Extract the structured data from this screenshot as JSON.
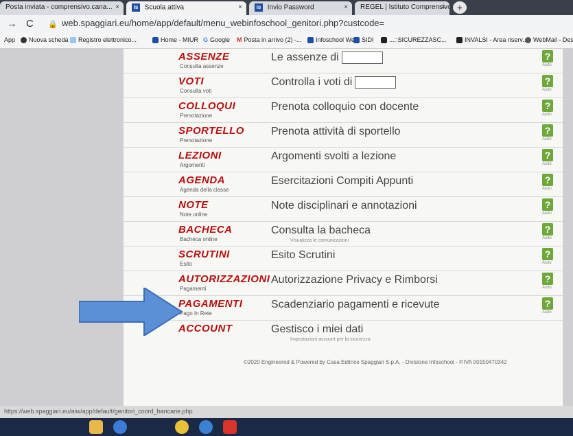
{
  "tabs": [
    {
      "label": "Posta inviata - comprensivo.cana...",
      "close": "×"
    },
    {
      "label": "Scuola attiva",
      "close": "×",
      "icon": "is"
    },
    {
      "label": "Invio Password",
      "close": "×",
      "icon": "is"
    },
    {
      "label": "REGEL | Istituto Comprensivo Ca...",
      "close": "×"
    }
  ],
  "newtab": "+",
  "address": {
    "url": "web.spaggiari.eu/home/app/default/menu_webinfoschool_genitori.php?custcode="
  },
  "bookmarks": [
    {
      "label": "App",
      "color": "#5f6368"
    },
    {
      "label": "Nuova scheda",
      "color": "#333333"
    },
    {
      "label": "Registro elettronico...",
      "color": "#4a90d9"
    },
    {
      "label": "Home - MIUR",
      "color": "#1e4fa3"
    },
    {
      "label": "Google",
      "color": "#4285f4"
    },
    {
      "label": "Posta in arrivo (2) -...",
      "color": "#d93025"
    },
    {
      "label": "Infoschool Web",
      "color": "#1e4fa3"
    },
    {
      "label": "SIDI",
      "color": "#1e4fa3"
    },
    {
      "label": "...::SICUREZZASC...",
      "color": "#222222"
    },
    {
      "label": "INVALSI - Area riserv...",
      "color": "#222222"
    },
    {
      "label": "WebMail - Desk",
      "color": "#333333"
    }
  ],
  "menu": [
    {
      "title": "ASSENZE",
      "subtitle": "Consulta assenze",
      "description": "Le assenze di",
      "name_box": true
    },
    {
      "title": "VOTI",
      "subtitle": "Consulta voti",
      "description": "Controlla i voti di",
      "name_box": true
    },
    {
      "title": "COLLOQUI",
      "subtitle": "Prenotazione",
      "description": "Prenota colloquio con docente"
    },
    {
      "title": "SPORTELLO",
      "subtitle": "Prenotazione",
      "description": "Prenota attività di sportello"
    },
    {
      "title": "LEZIONI",
      "subtitle": "Argomenti",
      "description": "Argomenti svolti a lezione"
    },
    {
      "title": "AGENDA",
      "subtitle": "Agenda della classe",
      "description": "Esercitazioni Compiti Appunti"
    },
    {
      "title": "NOTE",
      "subtitle": "Note online",
      "description": "Note disciplinari e annotazioni"
    },
    {
      "title": "BACHECA",
      "subtitle": "Bacheca online",
      "description": "Consulta la bacheca",
      "detail": "Visualizza le comunicazioni"
    },
    {
      "title": "SCRUTINI",
      "subtitle": "Esito",
      "description": "Esito Scrutini"
    },
    {
      "title": "AUTORIZZAZIONI",
      "subtitle": "Pagamenti",
      "description": "Autorizzazione Privacy e Rimborsi"
    },
    {
      "title": "PAGAMENTI",
      "subtitle": "Pago In Rete",
      "description": "Scadenziario pagamenti e ricevute"
    },
    {
      "title": "ACCOUNT",
      "subtitle": "",
      "description": "Gestisco i miei dati",
      "detail": "Impostazioni account per la sicurezza"
    }
  ],
  "help": {
    "symbol": "?",
    "label": "Aiuto"
  },
  "footer": "©2020 Engineered & Powered by Casa Editrice Spaggiari S.p.A. - Divisione Infoschool - P.IVA 00150470342",
  "status_url": "https://web.spaggiari.eu/aiw/app/default/genitori_coord_bancarie.php",
  "colors": {
    "title_red": "#b80f0f",
    "help_green": "#6fa83a",
    "arrow_blue": "#5b8fd6"
  }
}
